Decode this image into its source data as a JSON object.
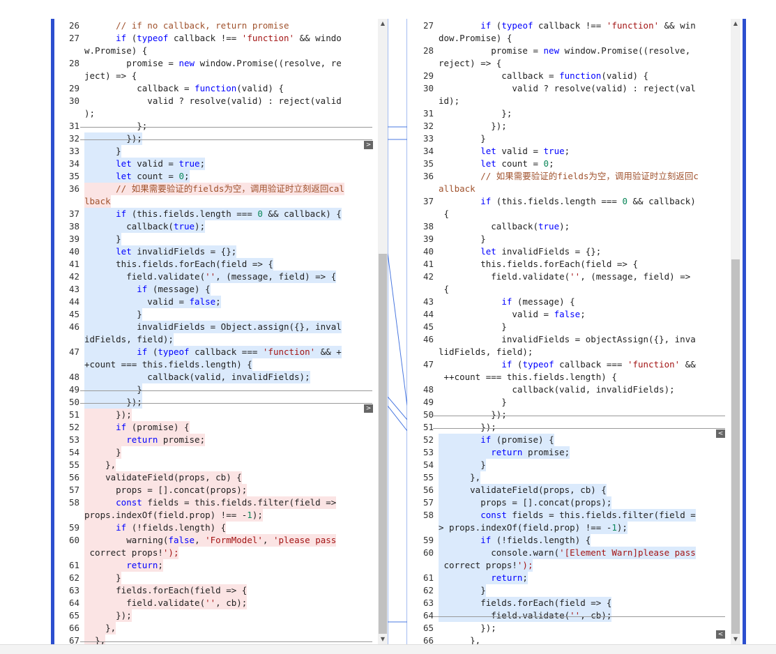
{
  "left": {
    "lines": [
      {
        "n": "26",
        "bg": "",
        "text": "      // if no callback, return promise"
      },
      {
        "n": "27",
        "bg": "",
        "text": "      if (typeof callback !== 'function' && windo"
      },
      {
        "n": "",
        "bg": "",
        "text": "w.Promise) {"
      },
      {
        "n": "28",
        "bg": "",
        "text": "        promise = new window.Promise((resolve, re"
      },
      {
        "n": "",
        "bg": "",
        "text": "ject) => {"
      },
      {
        "n": "29",
        "bg": "",
        "text": "          callback = function(valid) {"
      },
      {
        "n": "30",
        "bg": "",
        "text": "            valid ? resolve(valid) : reject(valid"
      },
      {
        "n": "",
        "bg": "",
        "text": ");"
      },
      {
        "n": "31",
        "bg": "",
        "text": "          };"
      },
      {
        "n": "32",
        "bg": "blue",
        "text": "        });"
      },
      {
        "n": "33",
        "bg": "blue",
        "text": "      }"
      },
      {
        "n": "34",
        "bg": "blue",
        "text": "      let valid = true;"
      },
      {
        "n": "35",
        "bg": "blue",
        "text": "      let count = 0;"
      },
      {
        "n": "36",
        "bg": "red",
        "text": "      // 如果需要验证的fields为空，调用验证时立刻返回cal"
      },
      {
        "n": "",
        "bg": "red",
        "text": "lback"
      },
      {
        "n": "37",
        "bg": "blue",
        "text": "      if (this.fields.length === 0 && callback) {"
      },
      {
        "n": "38",
        "bg": "blue",
        "text": "        callback(true);"
      },
      {
        "n": "39",
        "bg": "blue",
        "text": "      }"
      },
      {
        "n": "40",
        "bg": "blue",
        "text": "      let invalidFields = {};"
      },
      {
        "n": "41",
        "bg": "blue",
        "text": "      this.fields.forEach(field => {"
      },
      {
        "n": "42",
        "bg": "blue",
        "text": "        field.validate('', (message, field) => {"
      },
      {
        "n": "43",
        "bg": "blue",
        "text": "          if (message) {"
      },
      {
        "n": "44",
        "bg": "blue",
        "text": "            valid = false;"
      },
      {
        "n": "45",
        "bg": "blue",
        "text": "          }"
      },
      {
        "n": "46",
        "bg": "blue",
        "text": "          invalidFields = Object.assign({}, inval"
      },
      {
        "n": "",
        "bg": "blue",
        "text": "idFields, field);"
      },
      {
        "n": "47",
        "bg": "blue",
        "text": "          if (typeof callback === 'function' && +"
      },
      {
        "n": "",
        "bg": "blue",
        "text": "+count === this.fields.length) {"
      },
      {
        "n": "48",
        "bg": "blue",
        "text": "            callback(valid, invalidFields);"
      },
      {
        "n": "49",
        "bg": "blue",
        "text": "          }"
      },
      {
        "n": "50",
        "bg": "blue",
        "text": "        });"
      },
      {
        "n": "51",
        "bg": "red",
        "text": "      });"
      },
      {
        "n": "52",
        "bg": "red",
        "text": "      if (promise) {"
      },
      {
        "n": "53",
        "bg": "red",
        "text": "        return promise;"
      },
      {
        "n": "54",
        "bg": "red",
        "text": "      }"
      },
      {
        "n": "55",
        "bg": "red",
        "text": "    },"
      },
      {
        "n": "56",
        "bg": "red",
        "text": "    validateField(props, cb) {"
      },
      {
        "n": "57",
        "bg": "red",
        "text": "      props = [].concat(props);"
      },
      {
        "n": "58",
        "bg": "red",
        "text": "      const fields = this.fields.filter(field =>"
      },
      {
        "n": "",
        "bg": "red",
        "text": "props.indexOf(field.prop) !== -1);"
      },
      {
        "n": "59",
        "bg": "red",
        "text": "      if (!fields.length) {"
      },
      {
        "n": "60",
        "bg": "red",
        "text": "        warning(false, 'FormModel', 'please pass"
      },
      {
        "n": "",
        "bg": "red",
        "text": " correct props!');"
      },
      {
        "n": "61",
        "bg": "red",
        "text": "        return;"
      },
      {
        "n": "62",
        "bg": "red",
        "text": "      }"
      },
      {
        "n": "63",
        "bg": "red",
        "text": "      fields.forEach(field => {"
      },
      {
        "n": "64",
        "bg": "red",
        "text": "        field.validate('', cb);"
      },
      {
        "n": "65",
        "bg": "red",
        "text": "      });"
      },
      {
        "n": "66",
        "bg": "red",
        "text": "    },"
      },
      {
        "n": "67",
        "bg": "red",
        "text": "  },"
      }
    ],
    "collapse_icon": "expand-right-icon"
  },
  "right": {
    "lines": [
      {
        "n": "27",
        "bg": "",
        "text": "        if (typeof callback !== 'function' && win"
      },
      {
        "n": "",
        "bg": "",
        "text": "dow.Promise) {"
      },
      {
        "n": "28",
        "bg": "",
        "text": "          promise = new window.Promise((resolve,"
      },
      {
        "n": "",
        "bg": "",
        "text": "reject) => {"
      },
      {
        "n": "29",
        "bg": "",
        "text": "            callback = function(valid) {"
      },
      {
        "n": "30",
        "bg": "",
        "text": "              valid ? resolve(valid) : reject(val"
      },
      {
        "n": "",
        "bg": "",
        "text": "id);"
      },
      {
        "n": "31",
        "bg": "",
        "text": "            };"
      },
      {
        "n": "32",
        "bg": "",
        "text": "          });"
      },
      {
        "n": "33",
        "bg": "",
        "text": "        }"
      },
      {
        "n": "34",
        "bg": "",
        "text": "        let valid = true;"
      },
      {
        "n": "35",
        "bg": "",
        "text": "        let count = 0;"
      },
      {
        "n": "36",
        "bg": "",
        "text": "        // 如果需要验证的fields为空，调用验证时立刻返回c"
      },
      {
        "n": "",
        "bg": "",
        "text": "allback"
      },
      {
        "n": "37",
        "bg": "",
        "text": "        if (this.fields.length === 0 && callback)"
      },
      {
        "n": "",
        "bg": "",
        "text": " {"
      },
      {
        "n": "38",
        "bg": "",
        "text": "          callback(true);"
      },
      {
        "n": "39",
        "bg": "",
        "text": "        }"
      },
      {
        "n": "40",
        "bg": "",
        "text": "        let invalidFields = {};"
      },
      {
        "n": "41",
        "bg": "",
        "text": "        this.fields.forEach(field => {"
      },
      {
        "n": "42",
        "bg": "",
        "text": "          field.validate('', (message, field) =>"
      },
      {
        "n": "",
        "bg": "",
        "text": " {"
      },
      {
        "n": "43",
        "bg": "",
        "text": "            if (message) {"
      },
      {
        "n": "44",
        "bg": "",
        "text": "              valid = false;"
      },
      {
        "n": "45",
        "bg": "",
        "text": "            }"
      },
      {
        "n": "46",
        "bg": "",
        "text": "            invalidFields = objectAssign({}, inva"
      },
      {
        "n": "",
        "bg": "",
        "text": "lidFields, field);"
      },
      {
        "n": "47",
        "bg": "",
        "text": "            if (typeof callback === 'function' &&"
      },
      {
        "n": "",
        "bg": "",
        "text": " ++count === this.fields.length) {"
      },
      {
        "n": "48",
        "bg": "",
        "text": "              callback(valid, invalidFields);"
      },
      {
        "n": "49",
        "bg": "",
        "text": "            }"
      },
      {
        "n": "50",
        "bg": "",
        "text": "          });"
      },
      {
        "n": "51",
        "bg": "",
        "text": "        });"
      },
      {
        "n": "52",
        "bg": "blue",
        "text": "        if (promise) {"
      },
      {
        "n": "53",
        "bg": "blue",
        "text": "          return promise;"
      },
      {
        "n": "54",
        "bg": "blue",
        "text": "        }"
      },
      {
        "n": "55",
        "bg": "blue",
        "text": "      },"
      },
      {
        "n": "56",
        "bg": "blue",
        "text": "      validateField(props, cb) {"
      },
      {
        "n": "57",
        "bg": "blue",
        "text": "        props = [].concat(props);"
      },
      {
        "n": "58",
        "bg": "blue",
        "text": "        const fields = this.fields.filter(field ="
      },
      {
        "n": "",
        "bg": "blue",
        "text": "> props.indexOf(field.prop) !== -1);"
      },
      {
        "n": "59",
        "bg": "blue",
        "text": "        if (!fields.length) {"
      },
      {
        "n": "60",
        "bg": "blue",
        "text": "          console.warn('[Element Warn]please pass"
      },
      {
        "n": "",
        "bg": "blue",
        "text": " correct props!');"
      },
      {
        "n": "61",
        "bg": "blue",
        "text": "          return;"
      },
      {
        "n": "62",
        "bg": "blue",
        "text": "        }"
      },
      {
        "n": "63",
        "bg": "blue",
        "text": "        fields.forEach(field => {"
      },
      {
        "n": "64",
        "bg": "blue",
        "text": "          field.validate('', cb);"
      },
      {
        "n": "65",
        "bg": "",
        "text": "        });"
      },
      {
        "n": "66",
        "bg": "",
        "text": "      },"
      }
    ],
    "collapse_icon": "expand-left-icon"
  },
  "colors": {
    "added": "#dbeafc",
    "removed": "#fbe4e4",
    "rail": "#2c4fcf"
  },
  "scroll": {
    "left_position": 0.4,
    "right_position": 0.4
  },
  "icons": {
    "scroll_up": "arrow-up-icon",
    "scroll_down": "arrow-down-icon"
  }
}
